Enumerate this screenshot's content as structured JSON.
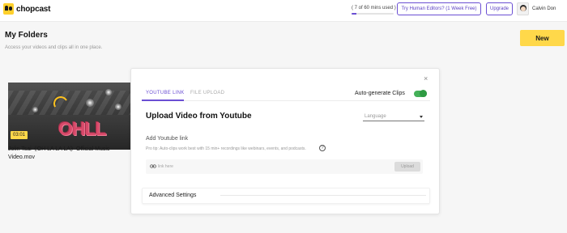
{
  "app": {
    "logo_text": "chopcast"
  },
  "header": {
    "usage_text": "( 7 of 60 mins used )",
    "usage_fraction": 0.1167,
    "try_editors_label": "Try Human Editors? (1 Week Free)",
    "upgrade_label": "Upgrade",
    "user_name": "Calvin Don"
  },
  "page": {
    "title": "My Folders",
    "subtitle": "Access your videos and clips all in one place.",
    "new_button_label": "New"
  },
  "video": {
    "duration": "03:01",
    "title": "Jolin Tsai《OH LA LA LA》Official Music Video.mov",
    "balloon_text": "OHLL"
  },
  "modal": {
    "close_label": "×",
    "tabs": [
      {
        "label": "YOUTUBE LINK",
        "active": true
      },
      {
        "label": "FILE UPLOAD",
        "active": false
      }
    ],
    "auto_generate_label": "Auto-generate Clips",
    "auto_generate_on": true,
    "upload_title": "Upload Video from Youtube",
    "language_placeholder": "Language",
    "add_link_label": "Add Youtube link",
    "pro_tip": "Pro tip: Auto-clips work best with 15 min+ recordings like webinars, events, and podcasts.",
    "help_label": "?",
    "link_placeholder": "link here",
    "upload_button_label": "Upload",
    "advanced_settings_label": "Advanced Settings"
  },
  "colors": {
    "accent": "#6b4fd3",
    "brand_yellow": "#ffd84a",
    "toggle_on": "#44b058"
  }
}
